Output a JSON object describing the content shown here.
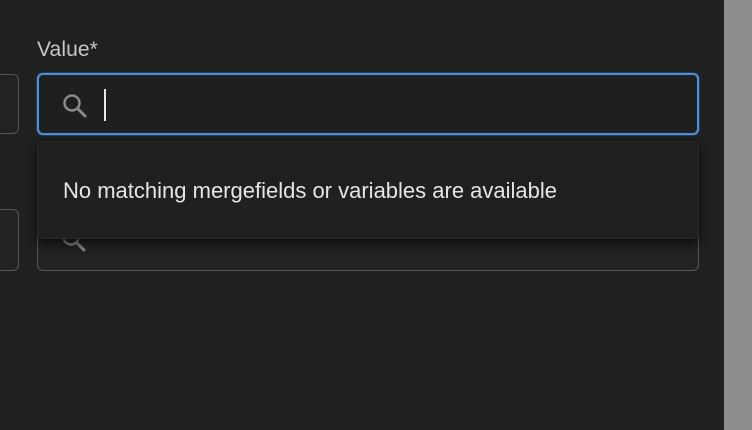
{
  "form": {
    "value_label": "Value*",
    "search_input_value": "",
    "search_icon": "search-icon"
  },
  "dropdown": {
    "empty_message": "No matching mergefields or variables are available"
  },
  "colors": {
    "background": "#202020",
    "focus_border": "#4b8fe0",
    "border": "#555555",
    "text": "#e5e5e5",
    "label": "#c7c7c7",
    "side_strip": "#8d8d8d"
  }
}
